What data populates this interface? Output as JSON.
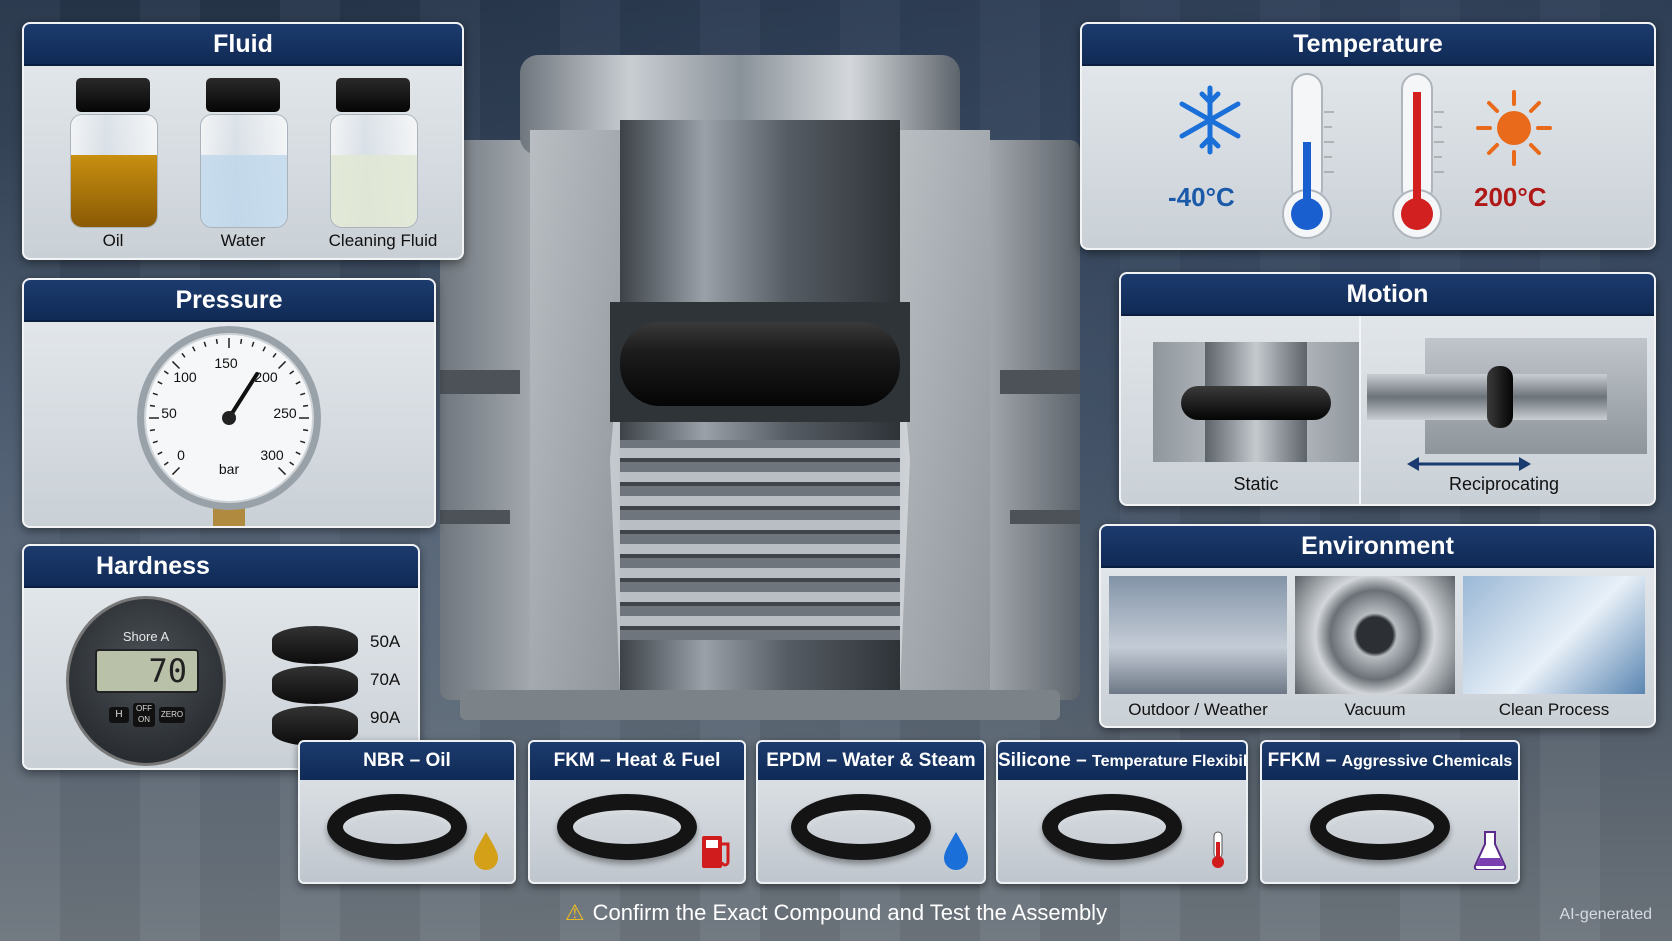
{
  "fluid": {
    "title": "Fluid",
    "items": [
      "Oil",
      "Water",
      "Cleaning Fluid"
    ]
  },
  "pressure": {
    "title": "Pressure",
    "ticks": [
      "0",
      "50",
      "100",
      "150",
      "200",
      "250",
      "300"
    ],
    "unit": "bar"
  },
  "hardness": {
    "title": "Hardness",
    "scale": "Shore A",
    "reading": "70",
    "buttons": [
      "H",
      "OFF ON",
      "ZERO"
    ],
    "grades": [
      "50A",
      "70A",
      "90A"
    ]
  },
  "temperature": {
    "title": "Temperature",
    "low": "-40°C",
    "high": "200°C"
  },
  "motion": {
    "title": "Motion",
    "items": [
      "Static",
      "Reciprocating"
    ]
  },
  "environment": {
    "title": "Environment",
    "items": [
      "Outdoor / Weather",
      "Vacuum",
      "Clean Process"
    ]
  },
  "compounds": [
    {
      "code": "NBR",
      "desc": "Oil",
      "icon": "oil-drop-icon",
      "color": "#d4a017"
    },
    {
      "code": "FKM",
      "desc": "Heat & Fuel",
      "icon": "fuel-pump-icon",
      "color": "#d01c1c"
    },
    {
      "code": "EPDM",
      "desc": "Water & Steam",
      "icon": "water-drop-icon",
      "color": "#1a6fd8"
    },
    {
      "code": "Silicone",
      "desc": "Temperature Flexibility",
      "icon": "thermometer-icon",
      "color": "#d01c1c"
    },
    {
      "code": "FFKM",
      "desc": "Aggressive Chemicals",
      "icon": "flask-icon",
      "color": "#7a3fb0"
    }
  ],
  "footer": {
    "warning": "Confirm the Exact Compound and Test the Assembly",
    "credit": "AI-generated"
  }
}
